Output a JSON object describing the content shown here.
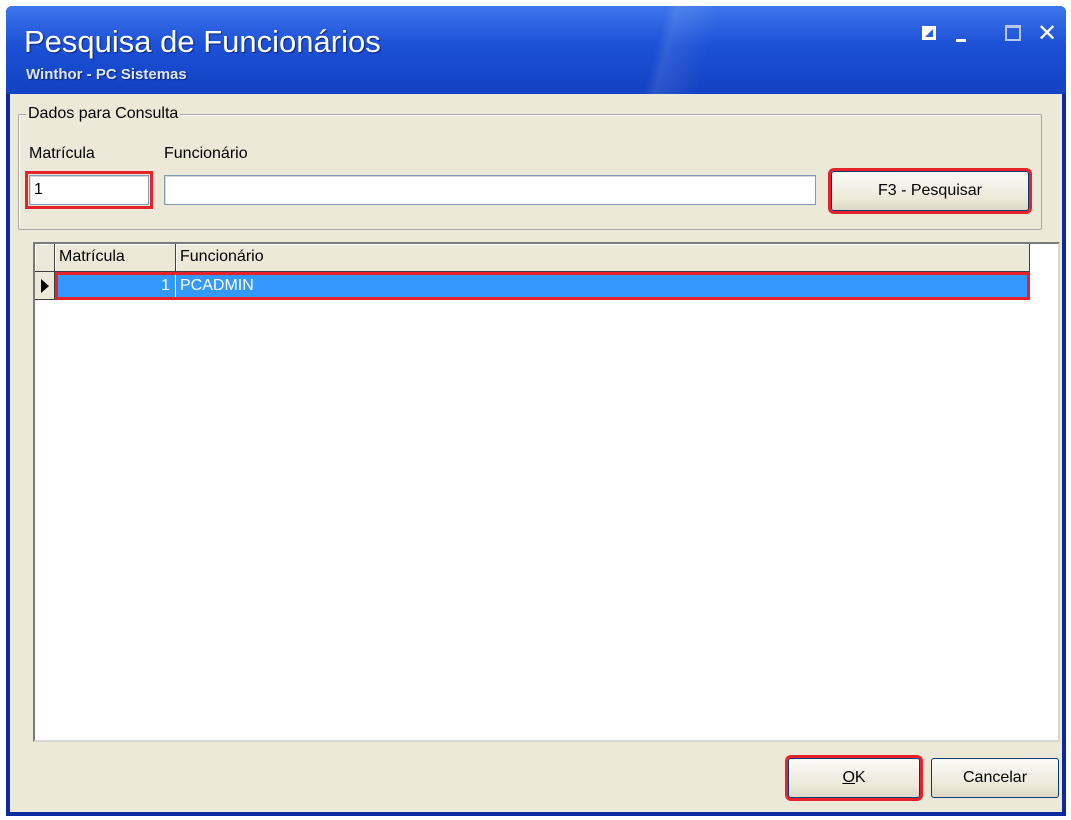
{
  "window": {
    "title": "Pesquisa de Funcionários",
    "subtitle": "Winthor - PC Sistemas",
    "controls": {
      "restore": "restore-icon",
      "minimize": "minimize-icon",
      "maximize": "maximize-icon",
      "close_glyph": "✕"
    }
  },
  "query": {
    "group_label": "Dados para Consulta",
    "matricula_label": "Matrícula",
    "funcionario_label": "Funcionário",
    "matricula_value": "1",
    "funcionario_value": "",
    "search_button": "F3 - Pesquisar"
  },
  "grid": {
    "columns": [
      "Matrícula",
      "Funcionário"
    ],
    "rows": [
      {
        "matricula": "1",
        "funcionario": "PCADMIN",
        "selected": true
      }
    ]
  },
  "footer": {
    "ok_mnemonic": "O",
    "ok_rest": "K",
    "cancel": "Cancelar"
  },
  "colors": {
    "titlebar": "#1c50d6",
    "selection": "#3399ff",
    "highlight": "#e8222a",
    "dialog_bg": "#ece9d8"
  }
}
